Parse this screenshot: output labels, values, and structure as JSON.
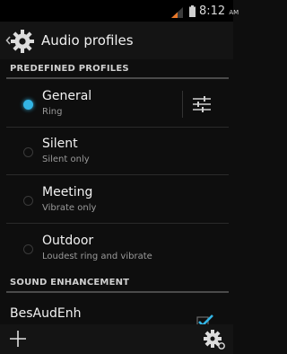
{
  "status_bar": {
    "time": "8:12",
    "ampm": "AM",
    "icons": [
      "signal-icon",
      "battery-icon"
    ]
  },
  "action_bar": {
    "title": "Audio profiles",
    "icons": [
      "up-caret-icon",
      "audio-profiles-app-icon"
    ]
  },
  "predefined_section": {
    "header": "PREDEFINED PROFILES",
    "profiles": [
      {
        "name": "General",
        "summary": "Ring",
        "selected": true
      },
      {
        "name": "Silent",
        "summary": "Silent only",
        "selected": false
      },
      {
        "name": "Meeting",
        "summary": "Vibrate only",
        "selected": false
      },
      {
        "name": "Outdoor",
        "summary": "Loudest ring and vibrate",
        "selected": false
      }
    ],
    "settings_icon": "equalizer-sliders-icon"
  },
  "sound_section": {
    "header": "SOUND ENHANCEMENT",
    "item_label": "BesAudEnh",
    "item_checked": true
  },
  "bottom_bar": {
    "icons": [
      "add-icon",
      "gear-settings-icon"
    ]
  },
  "colors": {
    "accent": "#33b5e5",
    "background": "#0e0e0e",
    "bar": "#141414"
  }
}
